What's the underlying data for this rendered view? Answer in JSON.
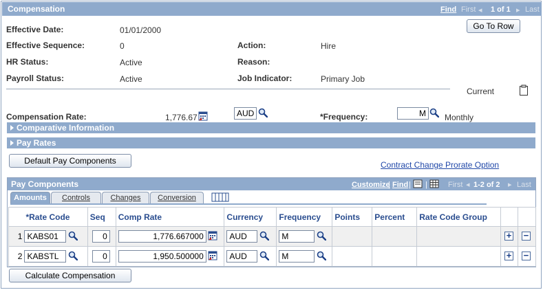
{
  "section": {
    "title": "Compensation",
    "find": "Find",
    "first": "First",
    "count": "1 of 1",
    "last": "Last",
    "go_to_row": "Go To Row"
  },
  "fields": {
    "effective_date_label": "Effective Date:",
    "effective_date": "01/01/2000",
    "effective_sequence_label": "Effective Sequence:",
    "effective_sequence": "0",
    "action_label": "Action:",
    "action": "Hire",
    "hr_status_label": "HR Status:",
    "hr_status": "Active",
    "reason_label": "Reason:",
    "reason": "",
    "payroll_status_label": "Payroll Status:",
    "payroll_status": "Active",
    "job_indicator_label": "Job Indicator:",
    "job_indicator": "Primary Job",
    "current": "Current",
    "comp_rate_label": "Compensation Rate:",
    "comp_rate": "1,776.67",
    "currency": "AUD",
    "frequency_label": "*Frequency:",
    "frequency": "M",
    "frequency_desc": "Monthly"
  },
  "collapsibles": {
    "comparative": "Comparative Information",
    "pay_rates": "Pay Rates"
  },
  "buttons": {
    "default_pay_components": "Default Pay Components",
    "contract_change": "Contract Change Prorate Option",
    "calculate": "Calculate Compensation"
  },
  "grid": {
    "title": "Pay Components",
    "customize": "Customize",
    "find": "Find",
    "first": "First",
    "count": "1-2 of 2",
    "last": "Last",
    "tabs": [
      "Amounts",
      "Controls",
      "Changes",
      "Conversion"
    ],
    "columns": [
      "*Rate Code",
      "Seq",
      "Comp Rate",
      "Currency",
      "Frequency",
      "Points",
      "Percent",
      "Rate Code Group"
    ],
    "rows": [
      {
        "num": "1",
        "rate_code": "KABS01",
        "seq": "0",
        "comp_rate": "1,776.667000",
        "currency": "AUD",
        "frequency": "M"
      },
      {
        "num": "2",
        "rate_code": "KABSTL",
        "seq": "0",
        "comp_rate": "1,950.500000",
        "currency": "AUD",
        "frequency": "M"
      }
    ]
  },
  "colors": {
    "header": "#8faacc",
    "link": "#1f47a8",
    "border": "#8fa3bf"
  }
}
